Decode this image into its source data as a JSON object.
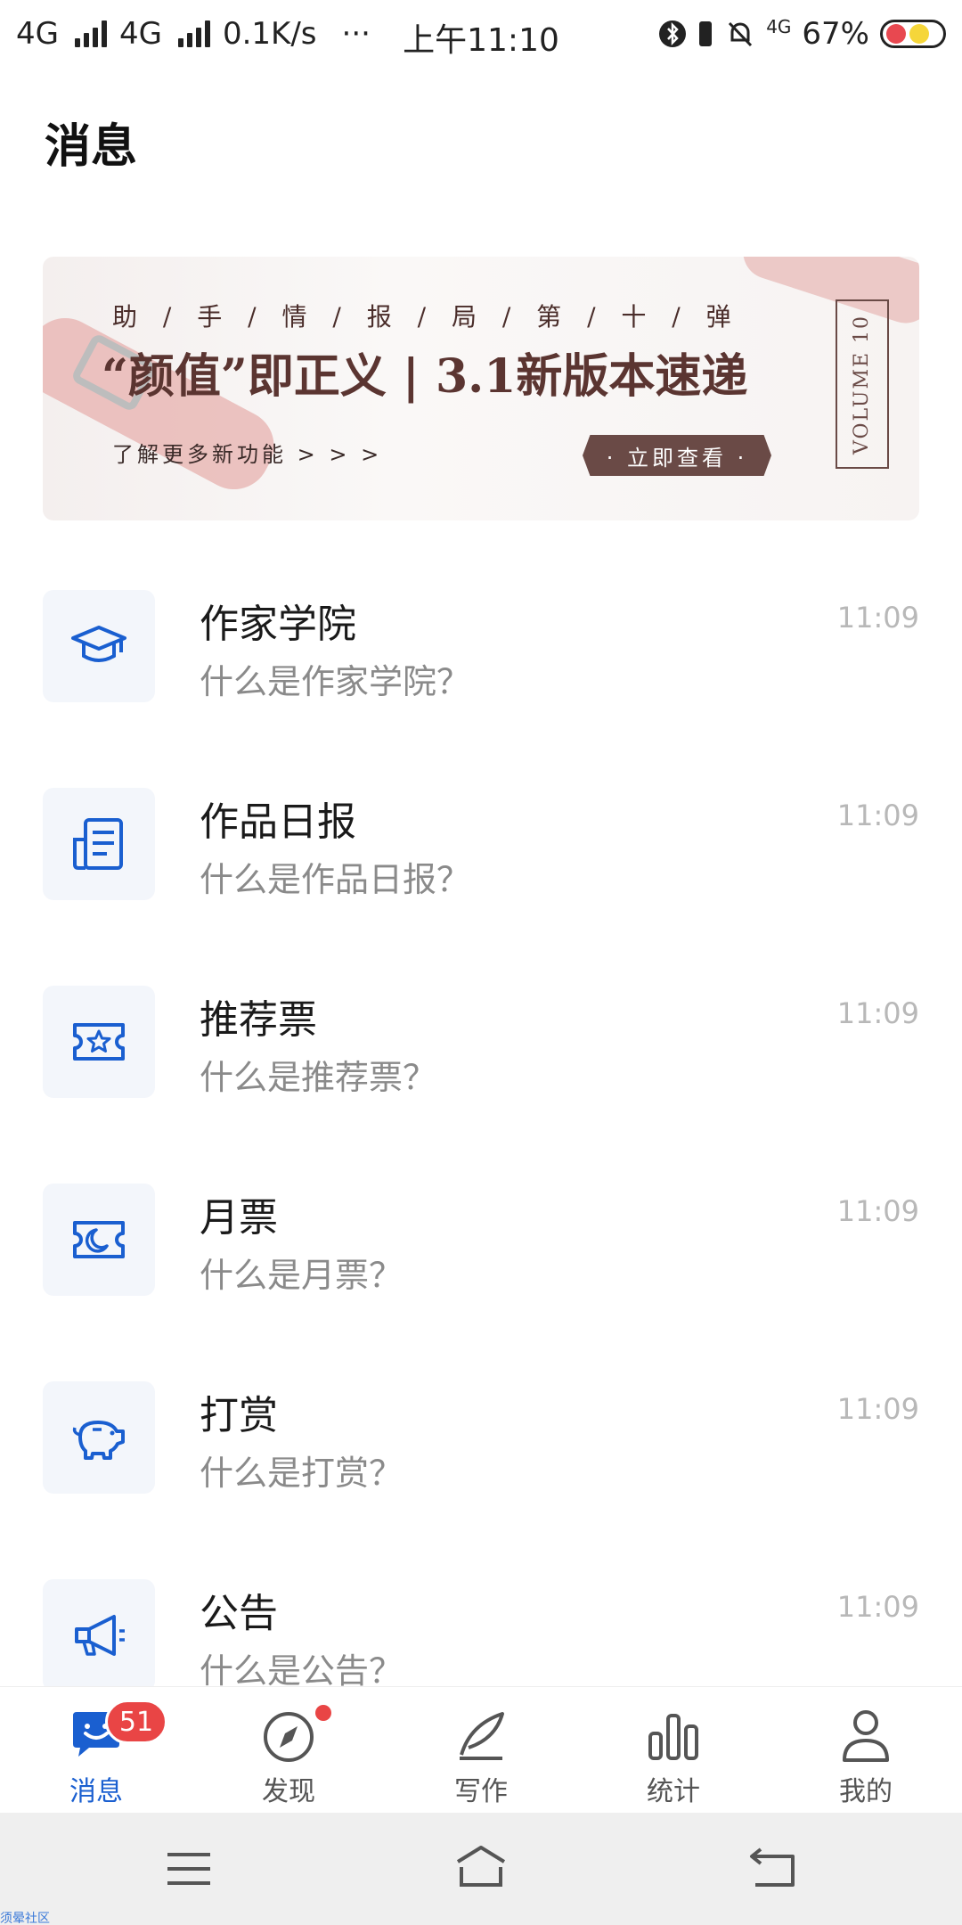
{
  "status_bar": {
    "left_text": "4G",
    "left_text2": "4G",
    "speed": "0.1K/s",
    "more": "···",
    "time": "上午11:10",
    "net_badge": "4G",
    "battery_pct": "67%"
  },
  "page": {
    "title": "消息"
  },
  "banner": {
    "subtitle": "助 / 手 / 情 / 报 / 局 / 第 / 十 / 弹",
    "headline": "“颜值”即正义 | 3.1新版本速递",
    "more_text": "了解更多新功能  > > >",
    "button_label": "· 立即查看 ·",
    "volume": "VOLUME 10"
  },
  "messages": [
    {
      "title": "作家学院",
      "preview": "什么是作家学院？",
      "time": "11:09",
      "icon": "graduation-cap-icon"
    },
    {
      "title": "作品日报",
      "preview": "什么是作品日报？",
      "time": "11:09",
      "icon": "newspaper-icon"
    },
    {
      "title": "推荐票",
      "preview": "什么是推荐票？",
      "time": "11:09",
      "icon": "star-ticket-icon"
    },
    {
      "title": "月票",
      "preview": "什么是月票？",
      "time": "11:09",
      "icon": "moon-ticket-icon"
    },
    {
      "title": "打赏",
      "preview": "什么是打赏？",
      "time": "11:09",
      "icon": "piggy-bank-icon"
    },
    {
      "title": "公告",
      "preview": "什么是公告？",
      "time": "11:09",
      "icon": "megaphone-icon"
    }
  ],
  "bottom_nav": {
    "items": [
      {
        "label": "消息",
        "icon": "chat-bubble-icon",
        "badge": "51",
        "active": true
      },
      {
        "label": "发现",
        "icon": "compass-icon",
        "dot": true
      },
      {
        "label": "写作",
        "icon": "quill-icon"
      },
      {
        "label": "统计",
        "icon": "bar-chart-icon"
      },
      {
        "label": "我的",
        "icon": "person-icon"
      }
    ]
  },
  "system_nav": {
    "menu": "menu-icon",
    "home": "home-icon",
    "back": "back-icon"
  },
  "watermark": "须晕社区",
  "colors": {
    "accent": "#1a5fd0",
    "badge": "#e94545",
    "icon_bg": "#f3f6fb",
    "banner_button": "#6a4a46"
  }
}
